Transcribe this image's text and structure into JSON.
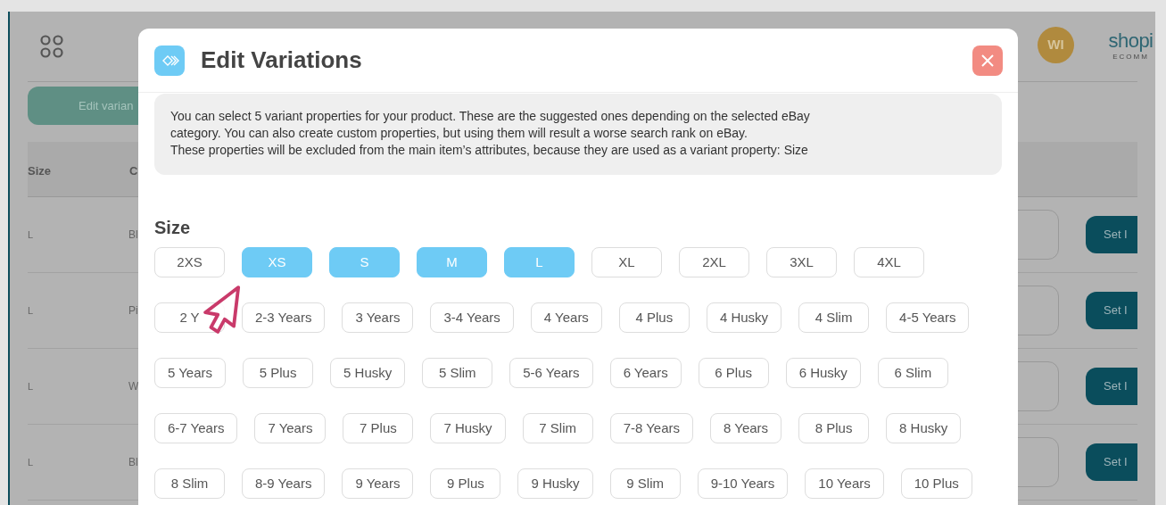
{
  "background": {
    "header": {
      "avatar": "WI",
      "logo": "shopi",
      "logo_subtitle": "ECOMM"
    },
    "edit_button": "Edit varian",
    "table": {
      "columns": [
        "Size",
        "C"
      ],
      "rows": [
        {
          "size": "L",
          "column_2": "Bl",
          "action": "Set I"
        },
        {
          "size": "L",
          "column_2": "Pi",
          "action": "Set I"
        },
        {
          "size": "L",
          "column_2": "W",
          "action": "Set I"
        },
        {
          "size": "L",
          "column_2": "Bl",
          "action": "Set I"
        }
      ]
    }
  },
  "modal": {
    "title": "Edit Variations",
    "info_lines": [
      "You can select 5 variant properties for your product. These are the suggested ones depending on the selected eBay",
      "category. You can also create custom properties, but using them will result a worse search rank on eBay.",
      "These properties will be excluded from the main item’s attributes, because they are used as a variant property: Size"
    ],
    "sections": [
      {
        "title": "Size",
        "rows": [
          [
            {
              "label": "2XS",
              "selected": false
            },
            {
              "label": "XS",
              "selected": true
            },
            {
              "label": "S",
              "selected": true
            },
            {
              "label": "M",
              "selected": true
            },
            {
              "label": "L",
              "selected": true
            },
            {
              "label": "XL",
              "selected": false
            },
            {
              "label": "2XL",
              "selected": false
            },
            {
              "label": "3XL",
              "selected": false
            },
            {
              "label": "4XL",
              "selected": false
            }
          ],
          [
            {
              "label": "2 Y",
              "selected": false
            },
            {
              "label": "2-3 Years",
              "selected": false
            },
            {
              "label": "3 Years",
              "selected": false
            },
            {
              "label": "3-4 Years",
              "selected": false
            },
            {
              "label": "4 Years",
              "selected": false
            },
            {
              "label": "4 Plus",
              "selected": false
            },
            {
              "label": "4 Husky",
              "selected": false
            },
            {
              "label": "4 Slim",
              "selected": false
            },
            {
              "label": "4-5 Years",
              "selected": false
            }
          ],
          [
            {
              "label": "5 Years",
              "selected": false
            },
            {
              "label": "5 Plus",
              "selected": false
            },
            {
              "label": "5 Husky",
              "selected": false
            },
            {
              "label": "5 Slim",
              "selected": false
            },
            {
              "label": "5-6 Years",
              "selected": false
            },
            {
              "label": "6 Years",
              "selected": false
            },
            {
              "label": "6 Plus",
              "selected": false
            },
            {
              "label": "6 Husky",
              "selected": false
            },
            {
              "label": "6 Slim",
              "selected": false
            }
          ],
          [
            {
              "label": "6-7 Years",
              "selected": false
            },
            {
              "label": "7 Years",
              "selected": false
            },
            {
              "label": "7 Plus",
              "selected": false
            },
            {
              "label": "7 Husky",
              "selected": false
            },
            {
              "label": "7 Slim",
              "selected": false
            },
            {
              "label": "7-8 Years",
              "selected": false
            },
            {
              "label": "8 Years",
              "selected": false
            },
            {
              "label": "8 Plus",
              "selected": false
            },
            {
              "label": "8 Husky",
              "selected": false
            }
          ],
          [
            {
              "label": "8 Slim",
              "selected": false
            },
            {
              "label": "8-9 Years",
              "selected": false
            },
            {
              "label": "9 Years",
              "selected": false
            },
            {
              "label": "9 Plus",
              "selected": false
            },
            {
              "label": "9 Husky",
              "selected": false
            },
            {
              "label": "9 Slim",
              "selected": false
            },
            {
              "label": "9-10 Years",
              "selected": false
            },
            {
              "label": "10 Years",
              "selected": false
            },
            {
              "label": "10 Plus",
              "selected": false
            }
          ]
        ]
      }
    ]
  }
}
